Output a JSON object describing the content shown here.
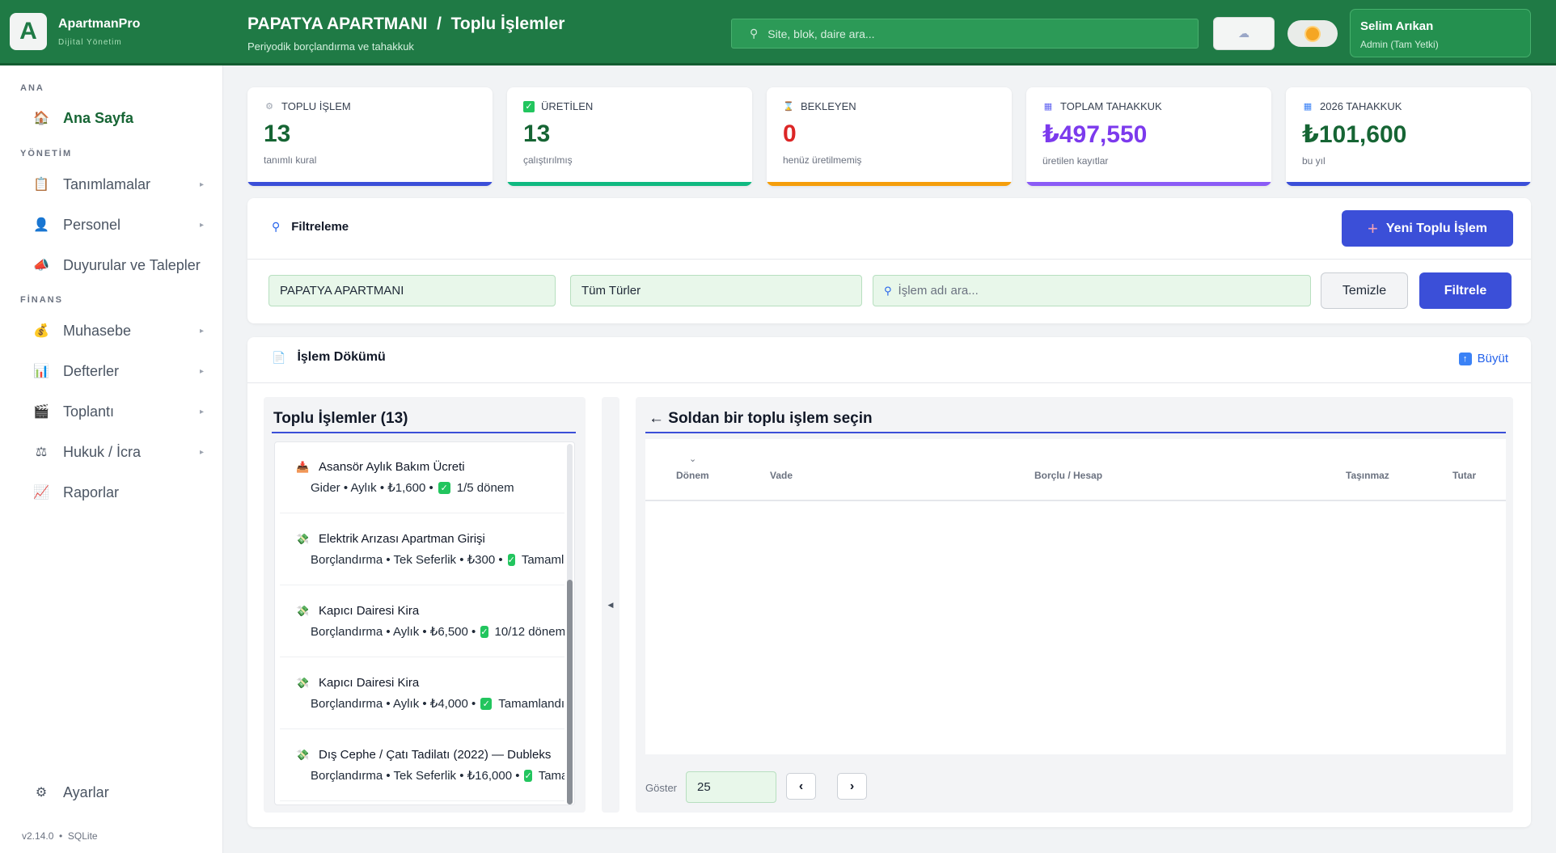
{
  "brand": {
    "logo_letter": "A",
    "name": "ApartmanPro",
    "subtitle": "Dijital Yönetim"
  },
  "header": {
    "title": "PAPATYA APARTMANI  /  Toplu İşlemler",
    "subtitle": "Periyodik borçlandırma ve tahakkuk",
    "search_placeholder": "Site, blok, daire ara...",
    "user": {
      "name": "Selim Arıkan",
      "role": "Admin (Tam Yetki)"
    }
  },
  "sidebar": {
    "sections": [
      {
        "label": "ANA"
      },
      {
        "label": "YÖNETİM"
      },
      {
        "label": "FİNANS"
      }
    ],
    "items": [
      {
        "label": "Ana Sayfa",
        "icon": "house-icon",
        "active": true
      },
      {
        "label": "Tanımlamalar",
        "icon": "clipboard-icon"
      },
      {
        "label": "Personel",
        "icon": "person-icon"
      },
      {
        "label": "Duyurular ve Talepler",
        "icon": "megaphone-icon"
      },
      {
        "label": "Muhasebe",
        "icon": "money-bag-icon"
      },
      {
        "label": "Defterler",
        "icon": "bar-chart-icon"
      },
      {
        "label": "Toplantı",
        "icon": "clapper-icon"
      },
      {
        "label": "Hukuk / İcra",
        "icon": "scales-icon"
      },
      {
        "label": "Raporlar",
        "icon": "trend-chart-icon"
      }
    ],
    "settings_label": "Ayarlar",
    "version": "v2.14.0  •  SQLite"
  },
  "stats": [
    {
      "label": "TOPLU İŞLEM",
      "value": "13",
      "note": "tanımlı kural",
      "color": "#3b4fd8",
      "value_color": "#166534"
    },
    {
      "label": "ÜRETİLEN",
      "value": "13",
      "note": "çalıştırılmış",
      "color": "#10b981",
      "value_color": "#166534"
    },
    {
      "label": "BEKLEYEN",
      "value": "0",
      "note": "henüz üretilmemiş",
      "color": "#f59e0b",
      "value_color": "#dc2626"
    },
    {
      "label": "TOPLAM TAHAKKUK",
      "value": "₺497,550",
      "note": "üretilen kayıtlar",
      "color": "#8b5cf6",
      "value_color": "#7c3aed"
    },
    {
      "label": "2026 TAHAKKUK",
      "value": "₺101,600",
      "note": "bu yıl",
      "color": "#3b4fd8",
      "value_color": "#166534"
    }
  ],
  "filter": {
    "title": "Filtreleme",
    "new_button": "Yeni Toplu İşlem",
    "site_value": "PAPATYA APARTMANI",
    "type_value": "Tüm Türler",
    "search_placeholder": "İşlem adı ara...",
    "clear_button": "Temizle",
    "filter_button": "Filtrele"
  },
  "main": {
    "title": "İşlem Dökümü",
    "grow_label": "Büyüt",
    "list_title": "Toplu İşlemler (13)",
    "items": [
      {
        "icon": "inbox-icon",
        "title": "Asansör Aylık Bakım Ücreti",
        "meta": "Gider • Aylık • ₺1,600 •",
        "status": "1/5 dönem"
      },
      {
        "icon": "money-icon",
        "title": "Elektrik Arızası Apartman Girişi",
        "meta": "Borçlandırma • Tek Seferlik • ₺300 •",
        "status": "Tamamlandı"
      },
      {
        "icon": "money-icon",
        "title": "Kapıcı Dairesi Kira",
        "meta": "Borçlandırma • Aylık • ₺6,500 •",
        "status": "10/12 dönem"
      },
      {
        "icon": "money-icon",
        "title": "Kapıcı Dairesi Kira",
        "meta": "Borçlandırma • Aylık • ₺4,000 •",
        "status": "Tamamlandı"
      },
      {
        "icon": "money-icon",
        "title": "Dış Cephe / Çatı Tadilatı (2022) — Dubleks",
        "meta": "Borçlandırma • Tek Seferlik • ₺16,000 •",
        "status": "Tamamlandı"
      }
    ],
    "detail_title": "← Soldan bir toplu işlem seçin",
    "columns": [
      "Dönem",
      "Vade",
      "Borçlu / Hesap",
      "Taşınmaz",
      "Tutar"
    ],
    "show_label": "Göster",
    "page_size": "25",
    "prev": "‹",
    "next": "›"
  }
}
